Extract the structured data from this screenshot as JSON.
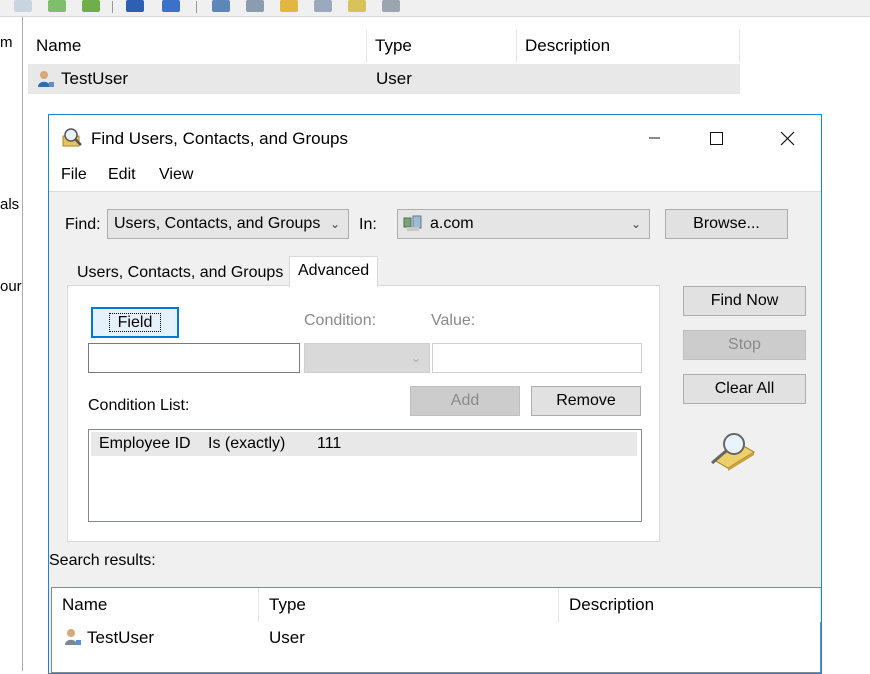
{
  "background": {
    "left_pane_fragments": [
      "m",
      "als",
      "our"
    ],
    "columns": [
      "Name",
      "Type",
      "Description"
    ],
    "rows": [
      {
        "name": "TestUser",
        "type": "User",
        "description": ""
      }
    ]
  },
  "dialog": {
    "title": "Find Users, Contacts, and Groups",
    "menu": [
      "File",
      "Edit",
      "View"
    ],
    "find_label": "Find:",
    "find_value": "Users, Contacts, and Groups",
    "in_label": "In:",
    "in_value": "a.com",
    "browse_label": "Browse...",
    "tabs": [
      "Users, Contacts, and Groups",
      "Advanced"
    ],
    "active_tab": "Advanced",
    "field_button": "Field",
    "condition_label": "Condition:",
    "value_label": "Value:",
    "field_input_value": "",
    "value_input_value": "",
    "add_label": "Add",
    "remove_label": "Remove",
    "condition_list_label": "Condition List:",
    "conditions": [
      {
        "field": "Employee ID",
        "condition": "Is (exactly)",
        "value": "111"
      }
    ],
    "find_now_label": "Find Now",
    "stop_label": "Stop",
    "clear_all_label": "Clear All",
    "search_results_label": "Search results:",
    "result_columns": [
      "Name",
      "Type",
      "Description"
    ],
    "results": [
      {
        "name": "TestUser",
        "type": "User",
        "description": ""
      }
    ]
  },
  "icons": {
    "toolbar": [
      "properties-icon",
      "refresh-icon",
      "export-icon",
      "help-icon",
      "console-tree-icon",
      "user-icon",
      "users-icon",
      "group-icon",
      "filter-icon",
      "find-icon",
      "group-move-icon"
    ],
    "user_row": "user-icon",
    "domain": "domain-icon",
    "dialog": "find-icon",
    "search_animation": "magnifier-icon"
  },
  "colors": {
    "accent_border": "#1883d7",
    "dialog_bg": "#f0f0f0",
    "selected_row": "#e8e8e8",
    "focus_border": "#0078d7"
  }
}
